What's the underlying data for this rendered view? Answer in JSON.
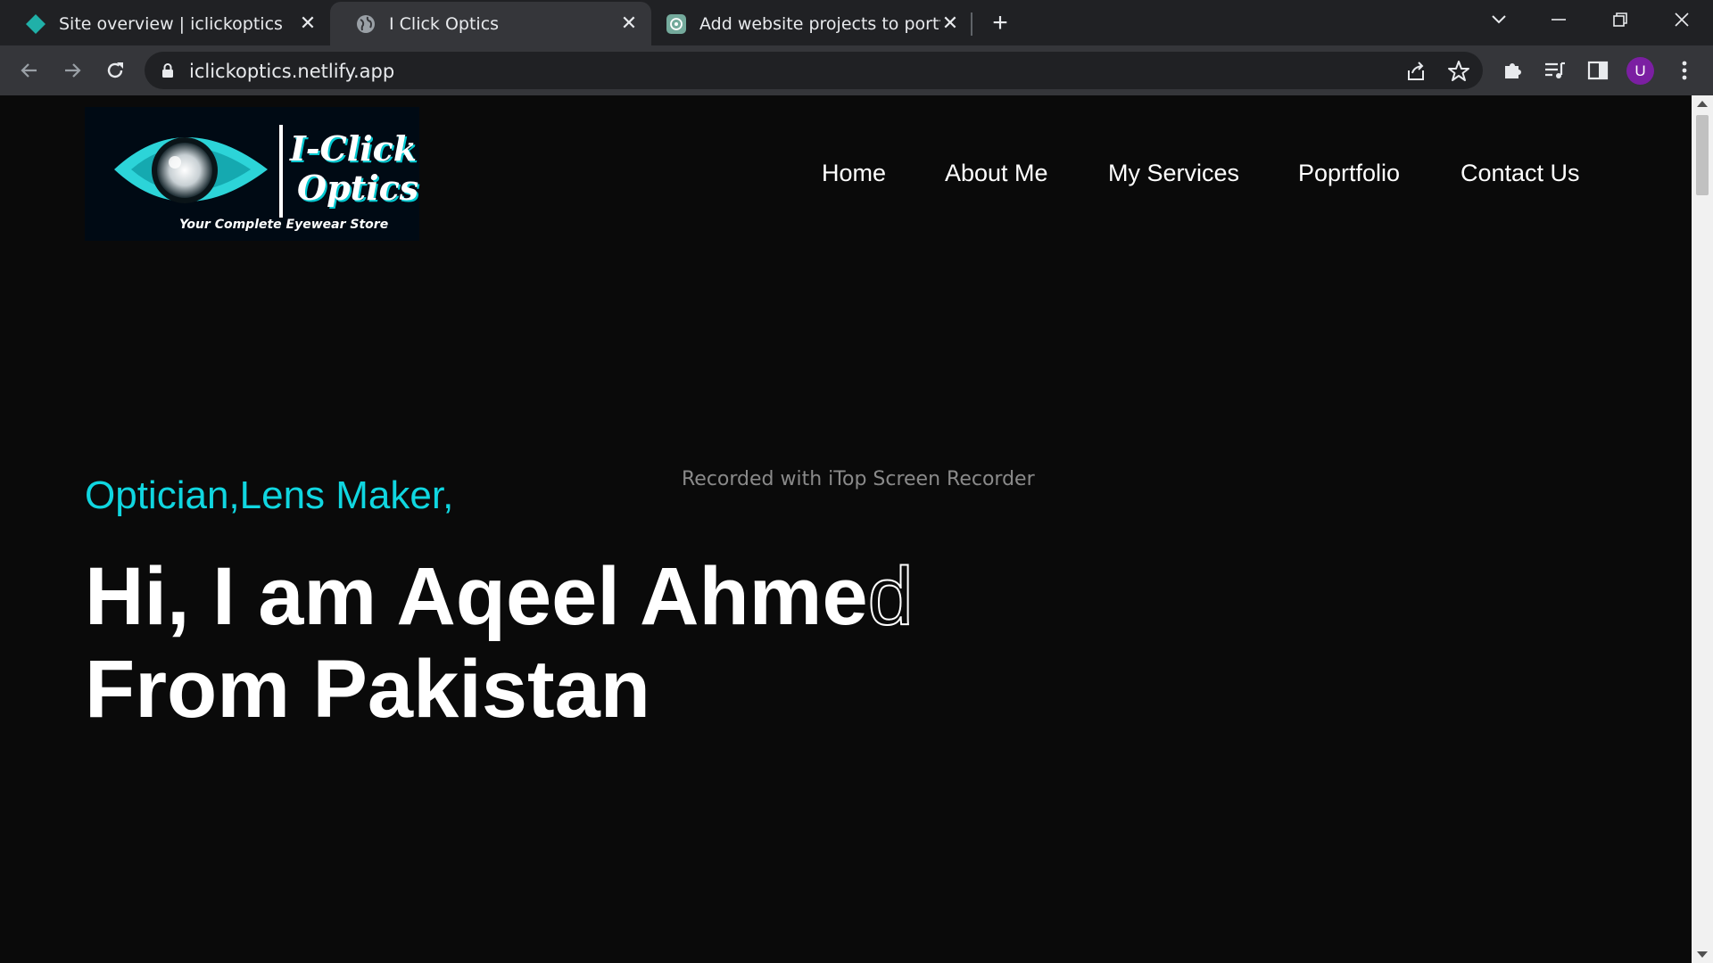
{
  "browser": {
    "tabs": [
      {
        "title": "Site overview | iclickoptics",
        "favicon": "netlify-diamond-icon",
        "active": false
      },
      {
        "title": "I Click Optics",
        "favicon": "globe-icon",
        "active": true
      },
      {
        "title": "Add website projects to portfolio",
        "favicon": "chatgpt-icon",
        "active": false
      }
    ],
    "url": "iclickoptics.netlify.app",
    "profile_initial": "U",
    "accent_profile": "#7b1fa2"
  },
  "site": {
    "logo": {
      "line1": "I-Click",
      "line2": "Optics",
      "tagline": "Your Complete Eyewear Store"
    },
    "nav": [
      "Home",
      "About Me",
      "My Services",
      "Poprtfolio",
      "Contact Us"
    ],
    "hero": {
      "roles": "Optician,Lens Maker,",
      "headline_line1_main": "Hi, I am Aqeel Ahme",
      "headline_line1_typing": "d",
      "headline_line2": "From Pakistan"
    },
    "colors": {
      "accent": "#10d6e0",
      "background": "#0a0a0a"
    }
  },
  "overlay": {
    "watermark": "Recorded with iTop Screen Recorder"
  }
}
